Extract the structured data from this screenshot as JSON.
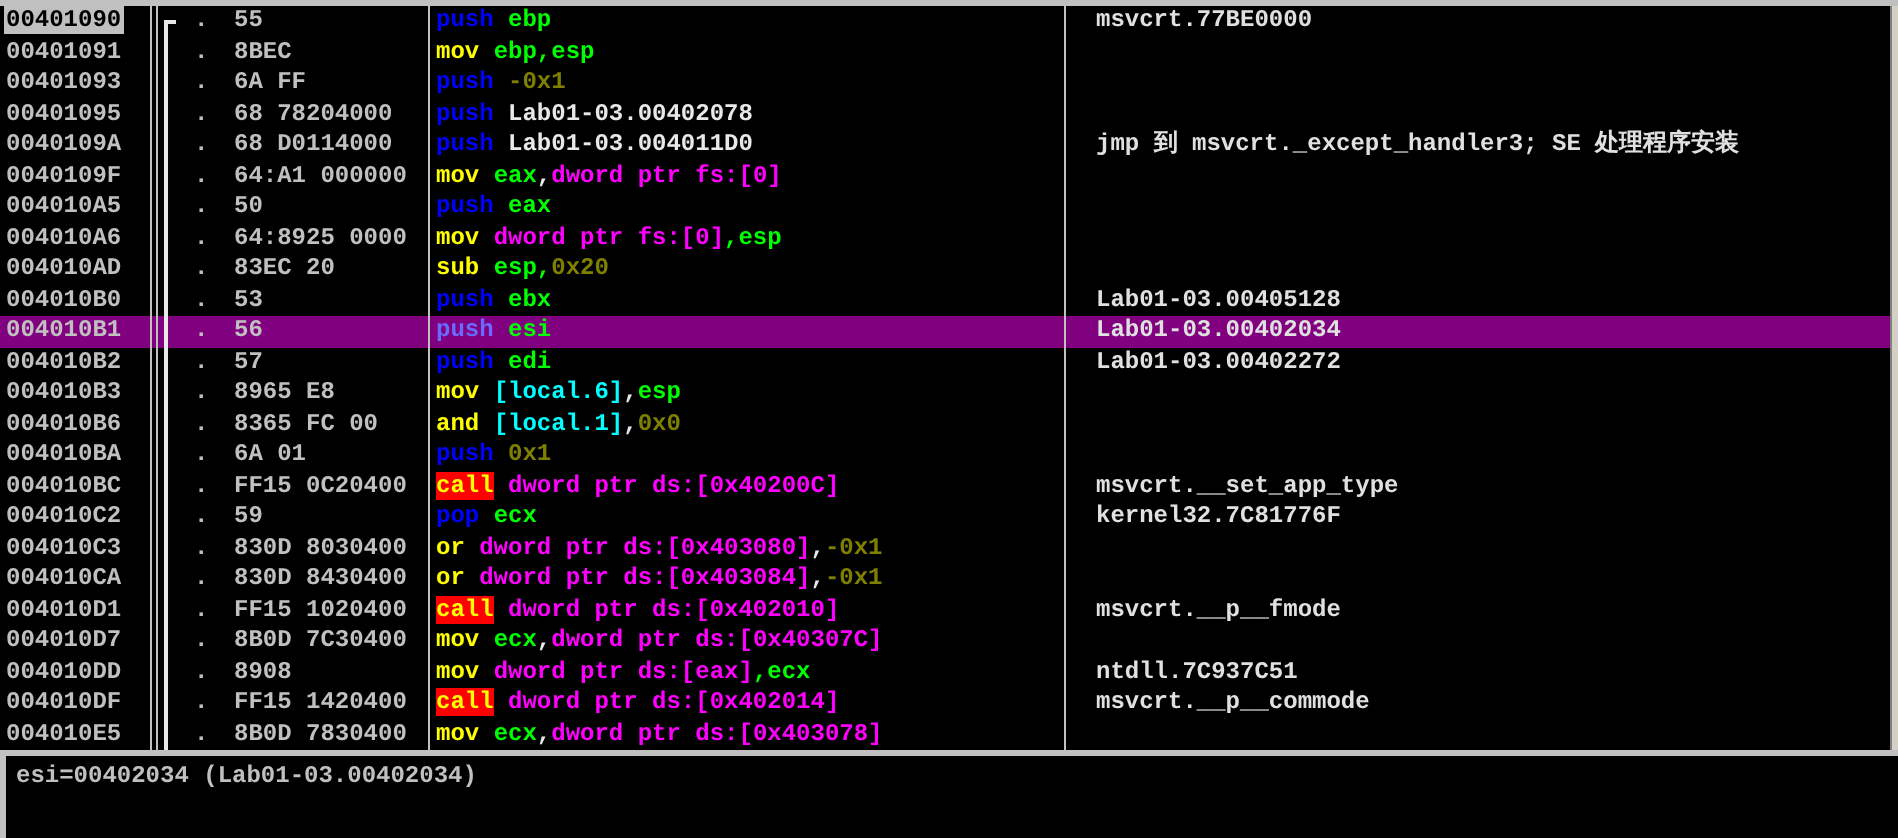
{
  "rows": [
    {
      "address": "00401090",
      "marked": true,
      "selected": false,
      "bracket_top": true,
      "flow": ".",
      "hex": "55",
      "mnemonic": {
        "kind": "stack",
        "text": "push"
      },
      "operands": [
        {
          "kind": "reg",
          "text": "ebp"
        }
      ],
      "comment": "msvcrt.77BE0000"
    },
    {
      "address": "00401091",
      "marked": false,
      "selected": false,
      "bracket_top": false,
      "flow": ".",
      "hex": "8BEC",
      "mnemonic": {
        "kind": "op",
        "text": "mov"
      },
      "operands": [
        {
          "kind": "reg",
          "text": "ebp,esp"
        }
      ]
    },
    {
      "address": "00401093",
      "marked": false,
      "selected": false,
      "bracket_top": false,
      "flow": ".",
      "hex": "6A FF",
      "mnemonic": {
        "kind": "stack",
        "text": "push"
      },
      "operands": [
        {
          "kind": "const",
          "text": "-0x1"
        }
      ]
    },
    {
      "address": "00401095",
      "marked": false,
      "selected": false,
      "bracket_top": false,
      "flow": ".",
      "hex": "68 78204000",
      "mnemonic": {
        "kind": "stack",
        "text": "push"
      },
      "operands": [
        {
          "kind": "sym",
          "text": "Lab01-03.00402078"
        }
      ]
    },
    {
      "address": "0040109A",
      "marked": false,
      "selected": false,
      "bracket_top": false,
      "flow": ".",
      "hex": "68 D0114000",
      "mnemonic": {
        "kind": "stack",
        "text": "push"
      },
      "operands": [
        {
          "kind": "sym",
          "text": "Lab01-03.004011D0"
        }
      ],
      "comment": "jmp 到 msvcrt._except_handler3; SE 处理程序安装"
    },
    {
      "address": "0040109F",
      "marked": false,
      "selected": false,
      "bracket_top": false,
      "flow": ".",
      "hex": "64:A1 000000",
      "mnemonic": {
        "kind": "op",
        "text": "mov"
      },
      "operands": [
        {
          "kind": "reg",
          "text": "eax"
        },
        {
          "kind": "punct",
          "text": ","
        },
        {
          "kind": "mem",
          "text": "dword ptr fs:[0]"
        }
      ]
    },
    {
      "address": "004010A5",
      "marked": false,
      "selected": false,
      "bracket_top": false,
      "flow": ".",
      "hex": "50",
      "mnemonic": {
        "kind": "stack",
        "text": "push"
      },
      "operands": [
        {
          "kind": "reg",
          "text": "eax"
        }
      ]
    },
    {
      "address": "004010A6",
      "marked": false,
      "selected": false,
      "bracket_top": false,
      "flow": ".",
      "hex": "64:8925 0000",
      "mnemonic": {
        "kind": "op",
        "text": "mov"
      },
      "operands": [
        {
          "kind": "mem",
          "text": "dword ptr fs:[0]"
        },
        {
          "kind": "reg",
          "text": ",esp"
        }
      ]
    },
    {
      "address": "004010AD",
      "marked": false,
      "selected": false,
      "bracket_top": false,
      "flow": ".",
      "hex": "83EC 20",
      "mnemonic": {
        "kind": "op",
        "text": "sub"
      },
      "operands": [
        {
          "kind": "reg",
          "text": "esp,"
        },
        {
          "kind": "const",
          "text": "0x20"
        }
      ]
    },
    {
      "address": "004010B0",
      "marked": false,
      "selected": false,
      "bracket_top": false,
      "flow": ".",
      "hex": "53",
      "mnemonic": {
        "kind": "stack",
        "text": "push"
      },
      "operands": [
        {
          "kind": "reg",
          "text": "ebx"
        }
      ],
      "comment": "Lab01-03.00405128"
    },
    {
      "address": "004010B1",
      "marked": false,
      "selected": true,
      "bracket_top": false,
      "flow": ".",
      "hex": "56",
      "mnemonic": {
        "kind": "stack",
        "text": "push"
      },
      "operands": [
        {
          "kind": "reg",
          "text": "esi"
        }
      ],
      "comment": "Lab01-03.00402034"
    },
    {
      "address": "004010B2",
      "marked": false,
      "selected": false,
      "bracket_top": false,
      "flow": ".",
      "hex": "57",
      "mnemonic": {
        "kind": "stack",
        "text": "push"
      },
      "operands": [
        {
          "kind": "reg",
          "text": "edi"
        }
      ],
      "comment": "Lab01-03.00402272"
    },
    {
      "address": "004010B3",
      "marked": false,
      "selected": false,
      "bracket_top": false,
      "flow": ".",
      "hex": "8965 E8",
      "mnemonic": {
        "kind": "op",
        "text": "mov"
      },
      "operands": [
        {
          "kind": "local",
          "text": "[local.6]"
        },
        {
          "kind": "punct",
          "text": ","
        },
        {
          "kind": "reg",
          "text": "esp"
        }
      ]
    },
    {
      "address": "004010B6",
      "marked": false,
      "selected": false,
      "bracket_top": false,
      "flow": ".",
      "hex": "8365 FC 00",
      "mnemonic": {
        "kind": "op",
        "text": "and"
      },
      "operands": [
        {
          "kind": "local",
          "text": "[local.1]"
        },
        {
          "kind": "punct",
          "text": ","
        },
        {
          "kind": "const",
          "text": "0x0"
        }
      ]
    },
    {
      "address": "004010BA",
      "marked": false,
      "selected": false,
      "bracket_top": false,
      "flow": ".",
      "hex": "6A 01",
      "mnemonic": {
        "kind": "stack",
        "text": "push"
      },
      "operands": [
        {
          "kind": "const",
          "text": "0x1"
        }
      ]
    },
    {
      "address": "004010BC",
      "marked": false,
      "selected": false,
      "bracket_top": false,
      "flow": ".",
      "hex": "FF15 0C20400",
      "mnemonic": {
        "kind": "call",
        "text": "call"
      },
      "operands": [
        {
          "kind": "mem",
          "text": "dword ptr ds:[0x40200C]"
        }
      ],
      "comment": "msvcrt.__set_app_type"
    },
    {
      "address": "004010C2",
      "marked": false,
      "selected": false,
      "bracket_top": false,
      "flow": ".",
      "hex": "59",
      "mnemonic": {
        "kind": "stack",
        "text": "pop"
      },
      "operands": [
        {
          "kind": "reg",
          "text": "ecx"
        }
      ],
      "comment": "kernel32.7C81776F"
    },
    {
      "address": "004010C3",
      "marked": false,
      "selected": false,
      "bracket_top": false,
      "flow": ".",
      "hex": "830D 8030400",
      "mnemonic": {
        "kind": "op",
        "text": "or"
      },
      "operands": [
        {
          "kind": "mem",
          "text": "dword ptr ds:[0x403080]"
        },
        {
          "kind": "punct",
          "text": ","
        },
        {
          "kind": "const",
          "text": "-0x1"
        }
      ]
    },
    {
      "address": "004010CA",
      "marked": false,
      "selected": false,
      "bracket_top": false,
      "flow": ".",
      "hex": "830D 8430400",
      "mnemonic": {
        "kind": "op",
        "text": "or"
      },
      "operands": [
        {
          "kind": "mem",
          "text": "dword ptr ds:[0x403084]"
        },
        {
          "kind": "punct",
          "text": ","
        },
        {
          "kind": "const",
          "text": "-0x1"
        }
      ]
    },
    {
      "address": "004010D1",
      "marked": false,
      "selected": false,
      "bracket_top": false,
      "flow": ".",
      "hex": "FF15 1020400",
      "mnemonic": {
        "kind": "call",
        "text": "call"
      },
      "operands": [
        {
          "kind": "mem",
          "text": "dword ptr ds:[0x402010]"
        }
      ],
      "comment": "msvcrt.__p__fmode"
    },
    {
      "address": "004010D7",
      "marked": false,
      "selected": false,
      "bracket_top": false,
      "flow": ".",
      "hex": "8B0D 7C30400",
      "mnemonic": {
        "kind": "op",
        "text": "mov"
      },
      "operands": [
        {
          "kind": "reg",
          "text": "ecx"
        },
        {
          "kind": "punct",
          "text": ","
        },
        {
          "kind": "mem",
          "text": "dword ptr ds:[0x40307C]"
        }
      ]
    },
    {
      "address": "004010DD",
      "marked": false,
      "selected": false,
      "bracket_top": false,
      "flow": ".",
      "hex": "8908",
      "mnemonic": {
        "kind": "op",
        "text": "mov"
      },
      "operands": [
        {
          "kind": "mem",
          "text": "dword ptr ds:[eax]"
        },
        {
          "kind": "reg",
          "text": ",ecx"
        }
      ],
      "comment": "ntdll.7C937C51"
    },
    {
      "address": "004010DF",
      "marked": false,
      "selected": false,
      "bracket_top": false,
      "flow": ".",
      "hex": "FF15 1420400",
      "mnemonic": {
        "kind": "call",
        "text": "call"
      },
      "operands": [
        {
          "kind": "mem",
          "text": "dword ptr ds:[0x402014]"
        }
      ],
      "comment": "msvcrt.__p__commode"
    },
    {
      "address": "004010E5",
      "marked": false,
      "selected": false,
      "bracket_top": false,
      "flow": ".",
      "hex": "8B0D 7830400",
      "mnemonic": {
        "kind": "op",
        "text": "mov"
      },
      "operands": [
        {
          "kind": "reg",
          "text": "ecx"
        },
        {
          "kind": "punct",
          "text": ","
        },
        {
          "kind": "mem",
          "text": "dword ptr ds:[0x403078]"
        }
      ]
    }
  ],
  "info": "esi=00402034 (Lab01-03.00402034)"
}
